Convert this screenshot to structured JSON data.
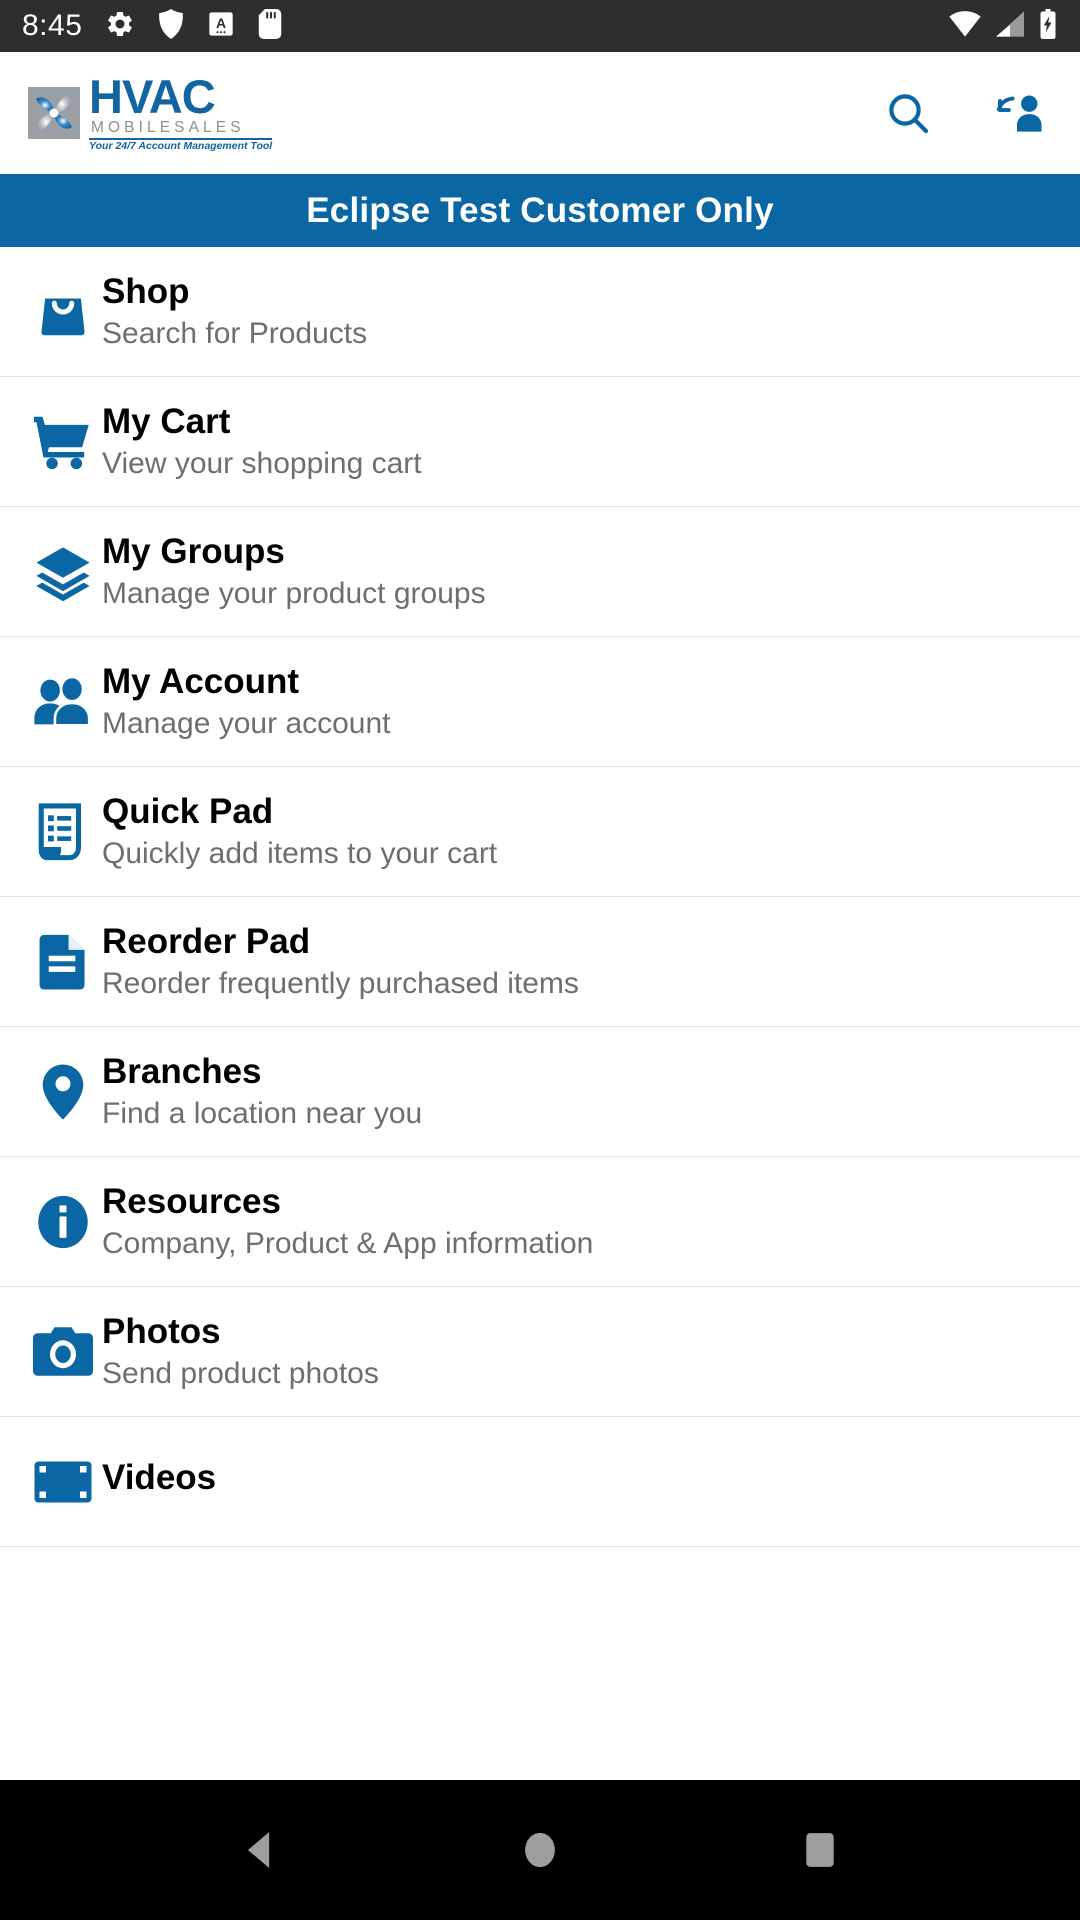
{
  "status_bar": {
    "time": "8:45",
    "left_icons": [
      "gear-icon",
      "shield-icon",
      "a-badge-icon",
      "sd-card-icon"
    ],
    "right_icons": [
      "wifi-icon",
      "cellular-signal-icon",
      "battery-charging-icon"
    ],
    "background": "#2e2e2e"
  },
  "header": {
    "logo": {
      "mark": "fan-pinwheel-logo",
      "title": "HVAC",
      "subtitle": "MOBILESALES",
      "tagline": "Your 24/7 Account Management Tool"
    },
    "actions": [
      {
        "name": "search-button",
        "icon": "search-icon"
      },
      {
        "name": "switch-account-button",
        "icon": "account-switch-icon"
      }
    ]
  },
  "banner": {
    "text": "Eclipse Test Customer Only",
    "background": "#0a67a3",
    "text_color": "#ffffff"
  },
  "accent_color": "#0a67a3",
  "menu": {
    "items": [
      {
        "title": "Shop",
        "subtitle": "Search for Products",
        "icon": "shopping-bag-icon"
      },
      {
        "title": "My Cart",
        "subtitle": "View your shopping cart",
        "icon": "shopping-cart-icon"
      },
      {
        "title": "My Groups",
        "subtitle": "Manage your product groups",
        "icon": "layers-icon"
      },
      {
        "title": "My Account",
        "subtitle": "Manage your account",
        "icon": "users-icon"
      },
      {
        "title": "Quick Pad",
        "subtitle": "Quickly add items to your cart",
        "icon": "list-receipt-icon"
      },
      {
        "title": "Reorder Pad",
        "subtitle": "Reorder frequently purchased items",
        "icon": "document-icon"
      },
      {
        "title": "Branches",
        "subtitle": "Find a location near you",
        "icon": "map-pin-icon"
      },
      {
        "title": "Resources",
        "subtitle": "Company, Product & App information",
        "icon": "info-circle-icon"
      },
      {
        "title": "Photos",
        "subtitle": "Send product photos",
        "icon": "camera-icon"
      },
      {
        "title": "Videos",
        "subtitle": "",
        "icon": "film-strip-icon"
      }
    ]
  },
  "nav_bar": {
    "buttons": [
      {
        "name": "back-button",
        "icon": "triangle-back-icon"
      },
      {
        "name": "home-button",
        "icon": "circle-home-icon"
      },
      {
        "name": "recents-button",
        "icon": "square-recents-icon"
      }
    ],
    "background": "#000000"
  }
}
